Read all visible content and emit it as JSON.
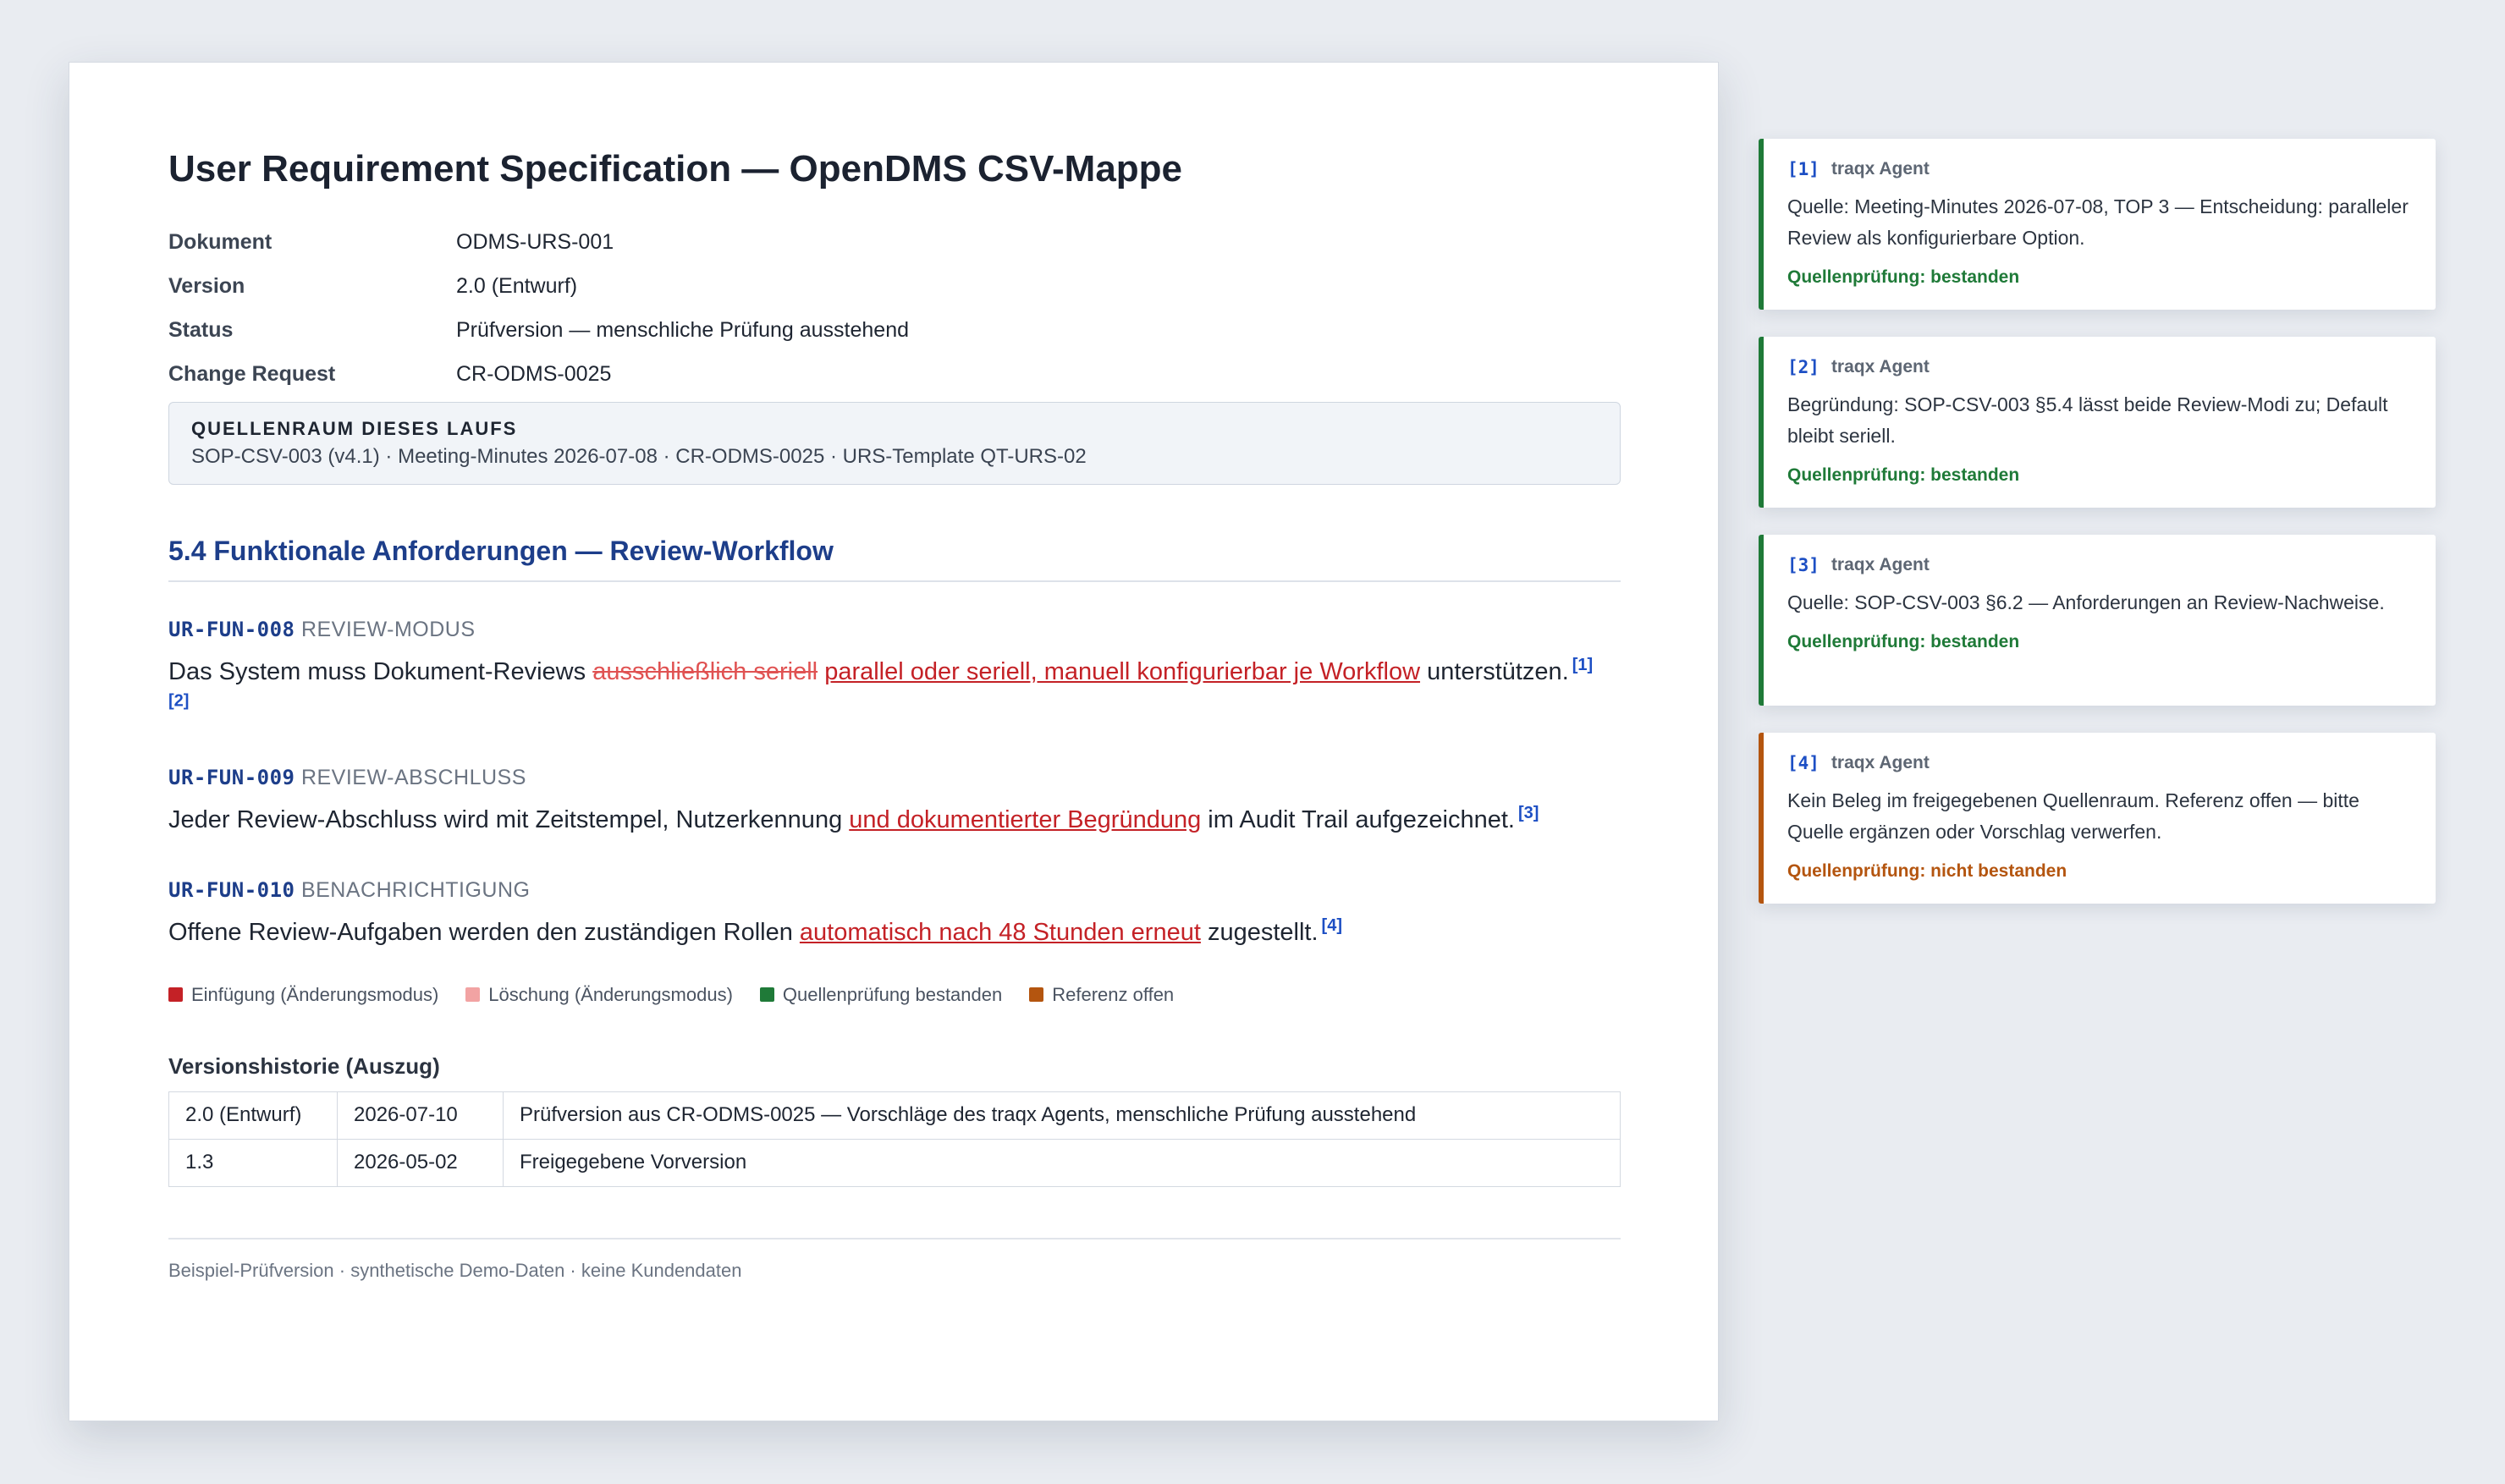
{
  "doc": {
    "title": "User Requirement Specification — OpenDMS CSV-Mappe",
    "meta": [
      {
        "key": "Dokument",
        "value": "ODMS-URS-001"
      },
      {
        "key": "Version",
        "value": "2.0 (Entwurf)"
      },
      {
        "key": "Status",
        "value": "Prüfversion — menschliche Prüfung ausstehend"
      },
      {
        "key": "Change Request",
        "value": "CR-ODMS-0025"
      }
    ],
    "source_box": {
      "heading": "QUELLENRAUM DIESES LAUFS",
      "text": "SOP-CSV-003 (v4.1) · Meeting-Minutes 2026-07-08 · CR-ODMS-0025 · URS-Template QT-URS-02"
    },
    "section_title": "5.4 Funktionale Anforderungen — Review-Workflow",
    "requirements": [
      {
        "id": "UR-FUN-008",
        "category": "REVIEW-MODUS",
        "pre": "Das System muss Dokument-Reviews ",
        "deleted": "ausschließlich seriell",
        "inserted": "parallel oder seriell, manuell konfigurierbar je Workflow",
        "post": " unterstützen.",
        "refs": [
          "[1]",
          "[2]"
        ]
      },
      {
        "id": "UR-FUN-009",
        "category": "REVIEW-ABSCHLUSS",
        "pre": "Jeder Review-Abschluss wird mit Zeitstempel, Nutzerkennung ",
        "inserted": "und dokumentierter Begründung",
        "post": " im Audit Trail aufgezeichnet.",
        "refs": [
          "[3]"
        ]
      },
      {
        "id": "UR-FUN-010",
        "category": "BENACHRICHTIGUNG",
        "pre": "Offene Review-Aufgaben werden den zuständigen Rollen ",
        "inserted": "automatisch nach 48 Stunden erneut",
        "post": " zugestellt.",
        "refs": [
          "[4]"
        ]
      }
    ],
    "legend": [
      {
        "label": "Einfügung (Änderungsmodus)",
        "color": "#c42126"
      },
      {
        "label": "Löschung (Änderungsmodus)",
        "color": "#f2a3a3"
      },
      {
        "label": "Quellenprüfung bestanden",
        "color": "#1f7a38"
      },
      {
        "label": "Referenz offen",
        "color": "#b4550f"
      }
    ],
    "history": {
      "title": "Versionshistorie (Auszug)",
      "rows": [
        [
          "2.0 (Entwurf)",
          "2026-07-10",
          "Prüfversion aus CR-ODMS-0025 — Vorschläge des traqx Agents, menschliche Prüfung ausstehend"
        ],
        [
          "1.3",
          "2026-05-02",
          "Freigegebene Vorversion"
        ]
      ]
    },
    "footer": "Beispiel-Prüfversion · synthetische Demo-Daten · keine Kundendaten"
  },
  "cards": [
    {
      "num": "[1]",
      "agent": "traqx Agent",
      "text": "Quelle: Meeting-Minutes 2026-07-08, TOP 3 — Entscheidung: paralleler Review als konfigurierbare Option.",
      "status": "Quellenprüfung: bestanden",
      "state": "pass"
    },
    {
      "num": "[2]",
      "agent": "traqx Agent",
      "text": "Begründung: SOP-CSV-003 §5.4 lässt beide Review-Modi zu; Default bleibt seriell.",
      "status": "Quellenprüfung: bestanden",
      "state": "pass"
    },
    {
      "num": "[3]",
      "agent": "traqx Agent",
      "text": "Quelle: SOP-CSV-003 §6.2 — Anforderungen an Review-Nachweise.",
      "status": "Quellenprüfung: bestanden",
      "state": "pass"
    },
    {
      "num": "[4]",
      "agent": "traqx Agent",
      "text": "Kein Beleg im freigegebenen Quellenraum. Referenz offen — bitte Quelle ergänzen oder Vorschlag verwerfen.",
      "status": "Quellenprüfung: nicht bestanden",
      "state": "fail"
    }
  ]
}
